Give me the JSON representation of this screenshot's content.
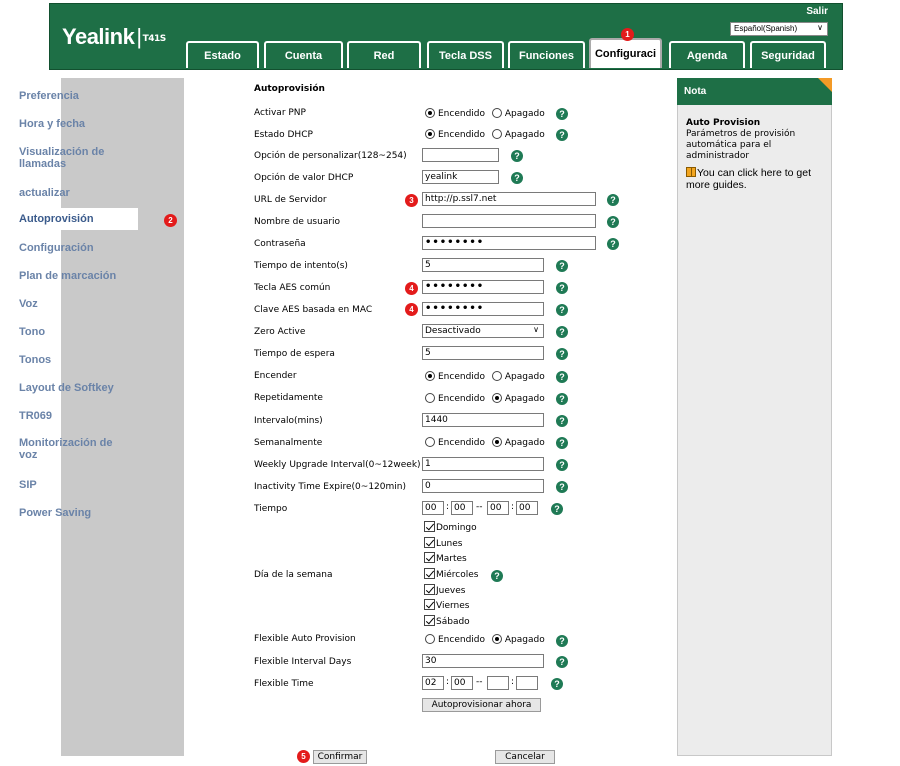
{
  "header": {
    "brand": "Yealink",
    "model": "T41S",
    "logout": "Salir",
    "language": "Español(Spanish)",
    "tabs": [
      "Estado",
      "Cuenta",
      "Red",
      "Tecla DSS",
      "Funciones",
      "Configuraci",
      "Agenda",
      "Seguridad"
    ],
    "active_tab": "Configuraci"
  },
  "sidebar": {
    "items": [
      "Preferencia",
      "Hora y fecha",
      "Visualización de llamadas",
      "actualizar",
      "Autoprovisión",
      "Configuración",
      "Plan de marcación",
      "Voz",
      "Tono",
      "Tonos",
      "Layout de Softkey",
      "TR069",
      "Monitorización de voz",
      "SIP",
      "Power Saving"
    ],
    "active": "Autoprovisión"
  },
  "form": {
    "section_title": "Autoprovisión",
    "radio_on": "Encendido",
    "radio_off": "Apagado",
    "fields": {
      "pnp": {
        "label": "Activar PNP",
        "value": "Encendido"
      },
      "dhcp": {
        "label": "Estado DHCP",
        "value": "Encendido"
      },
      "custom_option": {
        "label": "Opción de personalizar(128~254)",
        "value": ""
      },
      "dhcp_value": {
        "label": "Opción de valor DHCP",
        "value": "yealink"
      },
      "server_url": {
        "label": "URL de Servidor",
        "value": "http://p.ssl7.net"
      },
      "username": {
        "label": "Nombre de usuario",
        "value": ""
      },
      "password": {
        "label": "Contraseña",
        "value": "••••••••"
      },
      "retry_times": {
        "label": "Tiempo de intento(s)",
        "value": "5"
      },
      "aes_key": {
        "label": "Tecla AES común",
        "value": "••••••••"
      },
      "mac_aes_key": {
        "label": "Clave AES basada en MAC",
        "value": "••••••••"
      },
      "zero_active": {
        "label": "Zero Active",
        "value": "Desactivado"
      },
      "wait_time": {
        "label": "Tiempo de espera",
        "value": "5"
      },
      "power_on": {
        "label": "Encender",
        "value": "Encendido"
      },
      "repetitive": {
        "label": "Repetidamente",
        "value": "Apagado"
      },
      "interval": {
        "label": "Intervalo(mins)",
        "value": "1440"
      },
      "weekly": {
        "label": "Semanalmente",
        "value": "Apagado"
      },
      "weekly_interval": {
        "label": "Weekly Upgrade Interval(0~12week)",
        "value": "1"
      },
      "inactivity": {
        "label": "Inactivity Time Expire(0~120min)",
        "value": "0"
      },
      "time": {
        "label": "Tiempo",
        "start_h": "00",
        "start_m": "00",
        "end_h": "00",
        "end_m": "00"
      },
      "weekdays": {
        "label": "Día de la semana",
        "days": [
          "Domingo",
          "Lunes",
          "Martes",
          "Miércoles",
          "Jueves",
          "Viernes",
          "Sábado"
        ]
      },
      "flex_auto": {
        "label": "Flexible Auto Provision",
        "value": "Apagado"
      },
      "flex_days": {
        "label": "Flexible Interval Days",
        "value": "30"
      },
      "flex_time": {
        "label": "Flexible Time",
        "h1": "02",
        "m1": "00",
        "h2": "",
        "m2": ""
      }
    },
    "provision_now": "Autoprovisionar ahora",
    "confirm": "Confirmar",
    "cancel": "Cancelar"
  },
  "badges": [
    "1",
    "2",
    "3",
    "4",
    "4",
    "5"
  ],
  "note": {
    "header": "Nota",
    "title": "Auto Provision",
    "description": "Parámetros de provisión automática para el administrador",
    "guide": "You can click here to get more guides."
  },
  "colors": {
    "brand_green": "#1e6f46",
    "nav_text": "#6a83a8",
    "badge_red": "#e31b1b",
    "note_corner": "#f39a26"
  }
}
